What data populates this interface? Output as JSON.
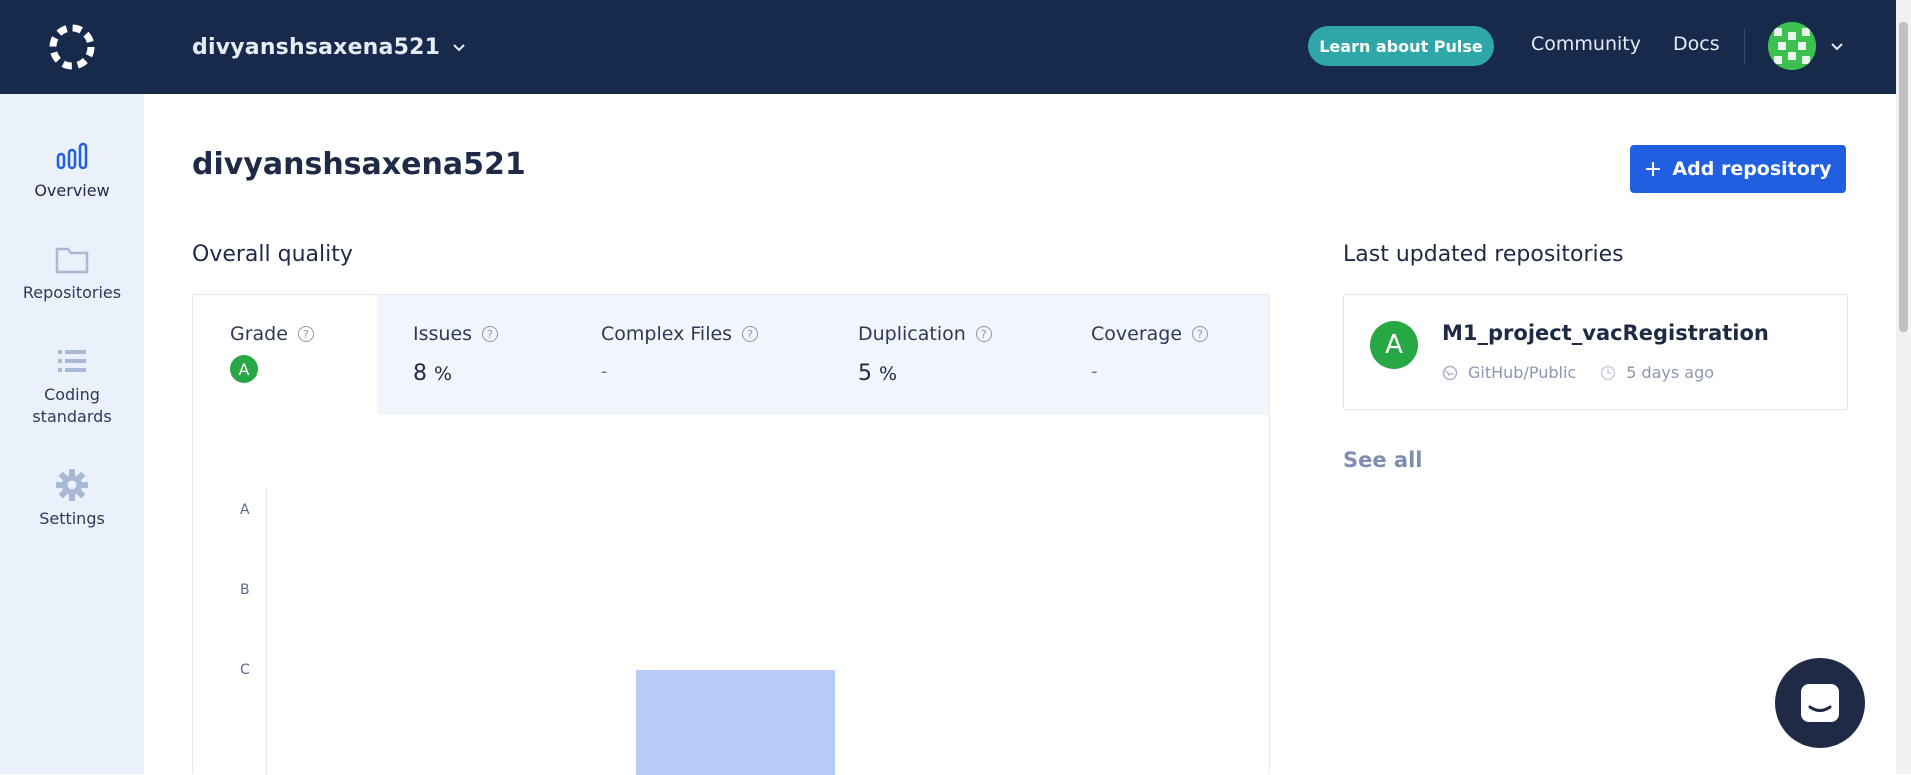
{
  "header": {
    "org_name": "divyanshsaxena521",
    "pulse_button": "Learn about Pulse",
    "links": [
      "Community",
      "Docs"
    ],
    "icons": [
      "codacy-logo-icon",
      "chevron-down-icon",
      "avatar-identicon",
      "chevron-down-icon"
    ]
  },
  "sidebar": {
    "items": [
      {
        "label": "Overview",
        "icon": "bar-chart-icon",
        "active": true
      },
      {
        "label": "Repositories",
        "icon": "folder-icon"
      },
      {
        "label": "Coding standards",
        "icon": "list-icon"
      },
      {
        "label": "Settings",
        "icon": "gear-icon"
      }
    ]
  },
  "main": {
    "title": "divyanshsaxena521",
    "add_repository": "Add repository",
    "overall_quality": {
      "title": "Overall quality",
      "metrics": [
        {
          "label": "Grade",
          "value": "A"
        },
        {
          "label": "Issues",
          "value": "8",
          "unit": "%"
        },
        {
          "label": "Complex Files",
          "value": "-"
        },
        {
          "label": "Duplication",
          "value": "5",
          "unit": "%"
        },
        {
          "label": "Coverage",
          "value": "-"
        }
      ]
    },
    "last_updated": {
      "title": "Last updated repositories",
      "repos": [
        {
          "grade": "A",
          "name": "M1_project_vacRegistration",
          "visibility": "GitHub/Public",
          "updated": "5 days ago"
        }
      ],
      "see_all": "See all"
    }
  },
  "chart_data": {
    "type": "bar",
    "y_categories": [
      "A",
      "B",
      "C"
    ],
    "bars": [
      {
        "value_grade_level": 2.5
      }
    ],
    "color": "#b8cbf7"
  },
  "colors": {
    "header_bg": "#172a4c",
    "sidebar_bg": "#eaf1fb",
    "accent": "#1f5fe0",
    "pulse": "#2fa6a8",
    "grade_a": "#28a745"
  }
}
